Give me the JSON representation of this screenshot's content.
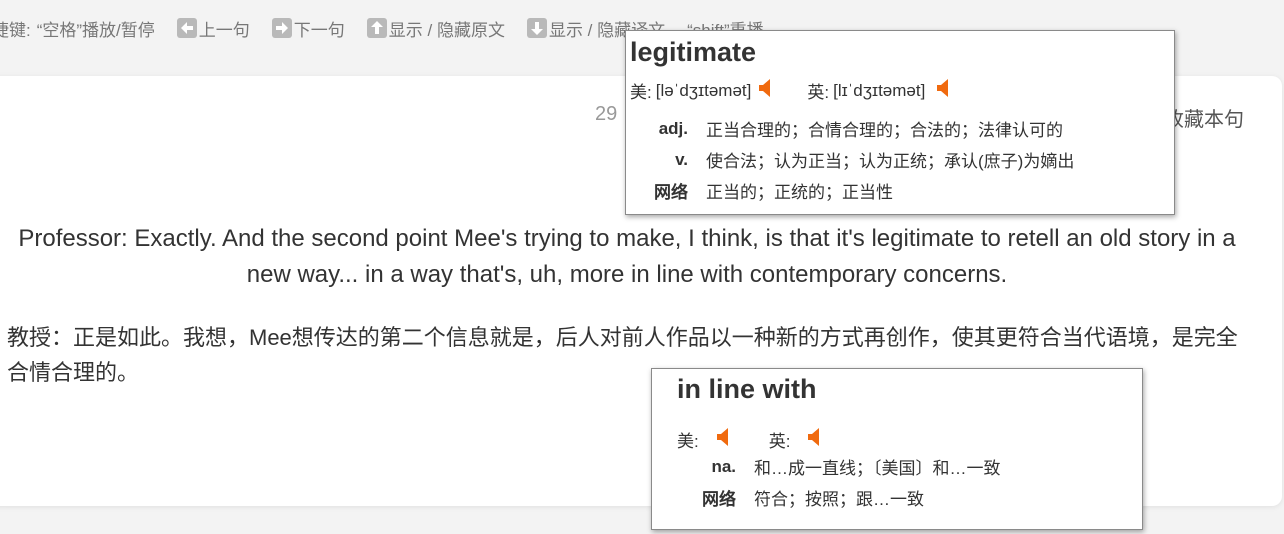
{
  "shortcuts": {
    "label": "捷键:",
    "space_play": "“空格”播放/暂停",
    "prev": "上一句",
    "next": "下一句",
    "toggle_original": "显示 / 隐藏原文",
    "toggle_translation": "显示 / 隐藏译文",
    "shift_replay": "“shift”重播"
  },
  "sentence": {
    "number": "29",
    "favorite": "收藏本句",
    "english": "Professor: Exactly. And the second point Mee's trying to make, I think, is that it's legitimate to retell an old story in a new way... in a way that's, uh, more in line with contemporary concerns.",
    "chinese": "教授：正是如此。我想，Mee想传达的第二个信息就是，后人对前人作品以一种新的方式再创作，使其更符合当代语境，是完全合情合理的。"
  },
  "popup_word": {
    "word": "legitimate",
    "us_label": "美:",
    "us_phonetic": "[ləˈdʒɪtəmət]",
    "uk_label": "英:",
    "uk_phonetic": "[lɪˈdʒɪtəmət]",
    "definitions": [
      {
        "pos": "adj.",
        "text": "正当合理的；合情合理的；合法的；法律认可的"
      },
      {
        "pos": "v.",
        "text": "使合法；认为正当；认为正统；承认(庶子)为嫡出"
      },
      {
        "pos": "网络",
        "text": "正当的；正统的；正当性"
      }
    ]
  },
  "popup_phrase": {
    "word": "in line with",
    "us_label": "美:",
    "uk_label": "英:",
    "definitions": [
      {
        "pos": "na.",
        "text": "和…成一直线；〔美国〕和…一致"
      },
      {
        "pos": "网络",
        "text": "符合；按照；跟…一致"
      }
    ]
  },
  "colors": {
    "speaker_icon": "#f06a0f",
    "key_icon": "#b9b9b9"
  }
}
